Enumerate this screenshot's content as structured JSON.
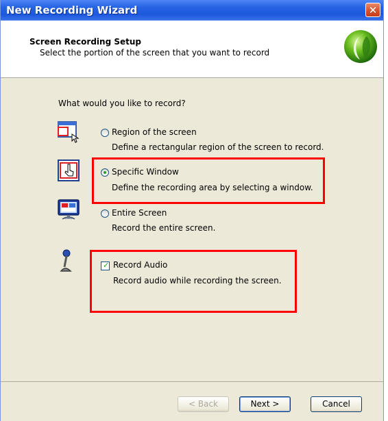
{
  "window": {
    "title": "New Recording Wizard",
    "close_symbol": "✕"
  },
  "header": {
    "title": "Screen Recording Setup",
    "subtitle": "Select the portion of the screen that you want to record",
    "logo_icon": "green-orb-logo"
  },
  "content": {
    "question": "What would you like to record?",
    "options": [
      {
        "label": "Region of the screen",
        "description": "Define a rectangular region of the screen to record.",
        "selected": false,
        "icon": "region-select-icon"
      },
      {
        "label": "Specific Window",
        "description": "Define the recording area by selecting a window.",
        "selected": true,
        "icon": "window-select-icon"
      },
      {
        "label": "Entire Screen",
        "description": "Record the entire screen.",
        "selected": false,
        "icon": "monitor-icon"
      }
    ],
    "audio": {
      "label": "Record Audio",
      "description": "Record audio while recording the screen.",
      "checked": true,
      "icon": "microphone-icon"
    }
  },
  "buttons": {
    "back": "< Back",
    "next": "Next >",
    "cancel": "Cancel"
  },
  "colors": {
    "titlebar": "#2664e4",
    "highlight": "#ff0000",
    "dialog_bg": "#ece9d8"
  }
}
